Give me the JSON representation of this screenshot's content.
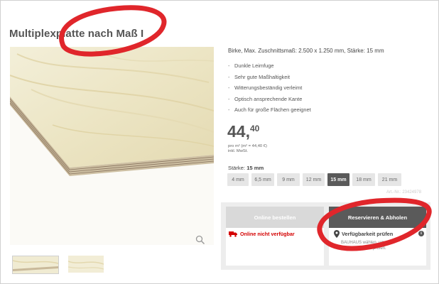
{
  "product": {
    "title": "Multiplexplatte nach Maß I",
    "subtitle": "Birke, Max. Zuschnittsmaß: 2.500 x 1.250 mm, Stärke: 15 mm",
    "features": [
      "Dunkle Leimfuge",
      "Sehr gute Maßhaltigkeit",
      "Witterungsbeständig verleimt",
      "Optisch ansprechende Kante",
      "Auch für große Flächen geeignet"
    ],
    "price_integer": "44,",
    "price_cents": "40",
    "unit_price": "pro m² (m² = 44,40 €)",
    "vat_note": "inkl. MwSt.",
    "article_number": "Art.-Nr.: 23424978"
  },
  "thickness": {
    "label": "Stärke:",
    "selected_value": "15 mm",
    "options": [
      "4 mm",
      "6,5 mm",
      "9 mm",
      "12 mm",
      "15 mm",
      "18 mm",
      "21 mm"
    ],
    "selected_index": 4
  },
  "purchase": {
    "online_button": "Online bestellen",
    "online_status": "Online nicht verfügbar",
    "reserve_button": "Reservieren & Abholen",
    "availability_link": "Verfügbarkeit prüfen",
    "availability_hint": "BAUHAUS wählen, um die Verfügbarkeit zu prüfen."
  },
  "icons": {
    "zoom": "magnifier-icon",
    "truck": "truck-icon",
    "pin": "location-pin-icon",
    "info": "info-icon"
  },
  "colors": {
    "error_red": "#d40000",
    "annotation_red": "#e0262b",
    "selected_chip": "#5a5a5a",
    "reserve_button": "#5a5a5a"
  }
}
